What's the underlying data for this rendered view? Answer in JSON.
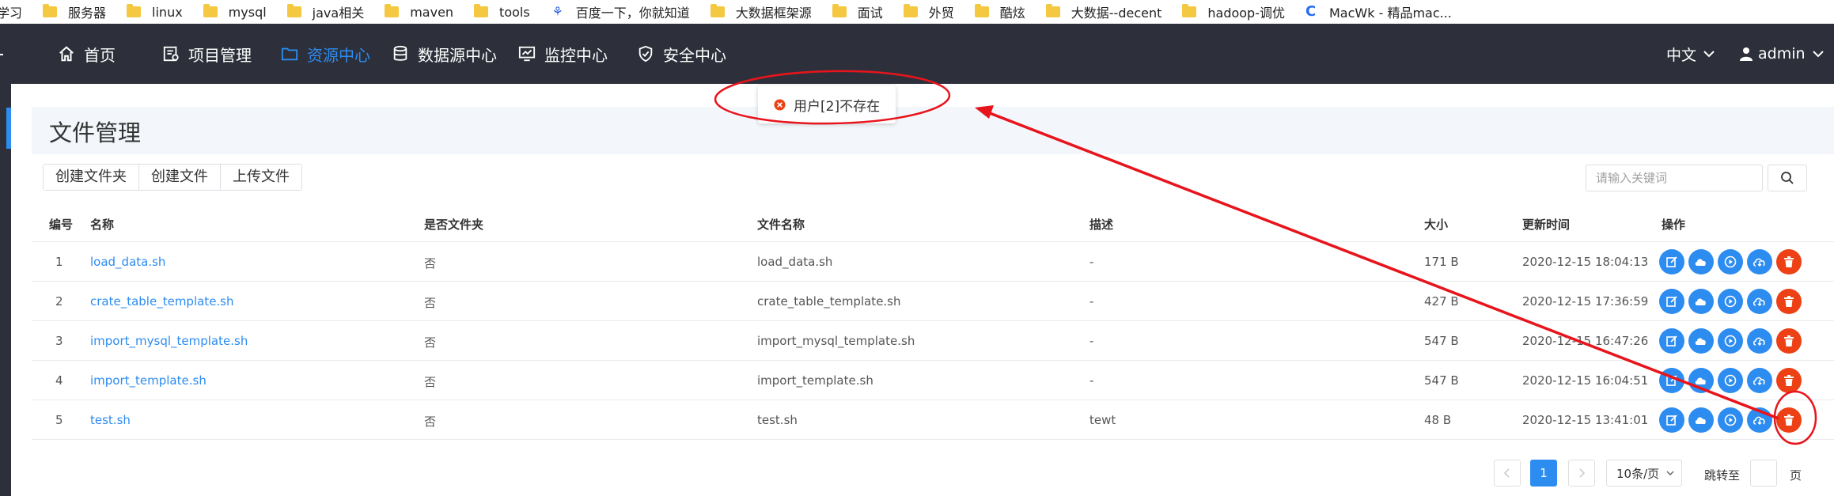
{
  "bookmarks": [
    {
      "label": "学习",
      "icon": "folder-icon"
    },
    {
      "label": "服务器",
      "icon": "folder-icon"
    },
    {
      "label": "linux",
      "icon": "folder-icon"
    },
    {
      "label": "mysql",
      "icon": "folder-icon"
    },
    {
      "label": "java相关",
      "icon": "folder-icon"
    },
    {
      "label": "maven",
      "icon": "folder-icon"
    },
    {
      "label": "tools",
      "icon": "folder-icon"
    },
    {
      "label": "百度一下，你就知道",
      "icon": "baidu-paw-icon"
    },
    {
      "label": "大数据框架源",
      "icon": "folder-icon"
    },
    {
      "label": "面试",
      "icon": "folder-icon"
    },
    {
      "label": "外贸",
      "icon": "folder-icon"
    },
    {
      "label": "酷炫",
      "icon": "folder-icon"
    },
    {
      "label": "大数据--decent",
      "icon": "folder-icon"
    },
    {
      "label": "hadoop-调优",
      "icon": "folder-icon"
    },
    {
      "label": "MacWk - 精品mac...",
      "icon": "macwk-icon"
    }
  ],
  "nav": {
    "items": [
      {
        "label": "首页",
        "icon": "home-icon",
        "active": false
      },
      {
        "label": "项目管理",
        "icon": "project-icon",
        "active": false
      },
      {
        "label": "资源中心",
        "icon": "folder-icon",
        "active": true
      },
      {
        "label": "数据源中心",
        "icon": "database-icon",
        "active": false
      },
      {
        "label": "监控中心",
        "icon": "monitor-icon",
        "active": false
      },
      {
        "label": "安全中心",
        "icon": "shield-icon",
        "active": false
      }
    ],
    "language": "中文",
    "user": "admin"
  },
  "page": {
    "title": "文件管理"
  },
  "toolbar": {
    "create_folder": "创建文件夹",
    "create_file": "创建文件",
    "upload_file": "上传文件",
    "search_placeholder": "请输入关键词"
  },
  "table": {
    "headers": {
      "id": "编号",
      "name": "名称",
      "is_dir": "是否文件夹",
      "file_name": "文件名称",
      "desc": "描述",
      "size": "大小",
      "updated": "更新时间",
      "ops": "操作"
    },
    "rows": [
      {
        "id": "1",
        "name": "load_data.sh",
        "is_dir": "否",
        "file_name": "load_data.sh",
        "desc": "-",
        "size": "171 B",
        "updated": "2020-12-15 18:04:13"
      },
      {
        "id": "2",
        "name": "crate_table_template.sh",
        "is_dir": "否",
        "file_name": "crate_table_template.sh",
        "desc": "-",
        "size": "427 B",
        "updated": "2020-12-15 17:36:59"
      },
      {
        "id": "3",
        "name": "import_mysql_template.sh",
        "is_dir": "否",
        "file_name": "import_mysql_template.sh",
        "desc": "-",
        "size": "547 B",
        "updated": "2020-12-15 16:47:26"
      },
      {
        "id": "4",
        "name": "import_template.sh",
        "is_dir": "否",
        "file_name": "import_template.sh",
        "desc": "-",
        "size": "547 B",
        "updated": "2020-12-15 16:04:51"
      },
      {
        "id": "5",
        "name": "test.sh",
        "is_dir": "否",
        "file_name": "test.sh",
        "desc": "tewt",
        "size": "48 B",
        "updated": "2020-12-15 13:41:01"
      }
    ]
  },
  "pagination": {
    "current": "1",
    "page_size": "10条/页",
    "jump_label": "跳转至",
    "page_unit": "页"
  },
  "message": {
    "text": "用户[2]不存在",
    "type": "error"
  },
  "colors": {
    "nav_bg": "#2d303a",
    "accent": "#2d8cf0",
    "danger": "#ed4014",
    "annotation": "#e8141c"
  }
}
